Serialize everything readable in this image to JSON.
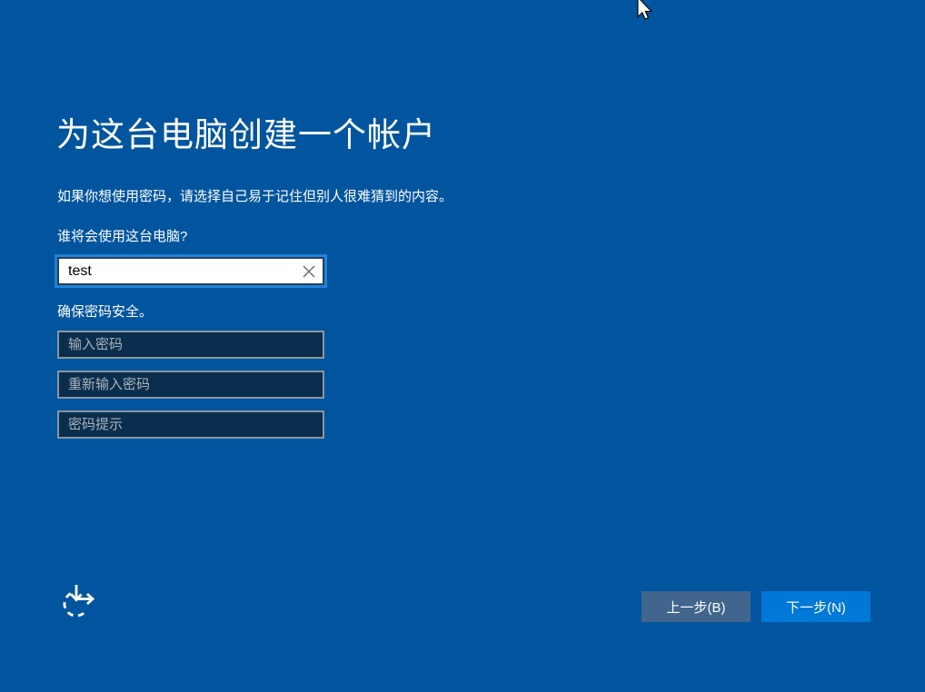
{
  "header": {
    "title": "为这台电脑创建一个帐户",
    "subtitle": "如果你想使用密码，请选择自己易于记住但别人很难猜到的内容。"
  },
  "form": {
    "username_label": "谁将会使用这台电脑?",
    "username_value": "test",
    "password_section_label": "确保密码安全。",
    "password_placeholder": "输入密码",
    "confirm_password_placeholder": "重新输入密码",
    "password_hint_placeholder": "密码提示"
  },
  "footer": {
    "back_label": "上一步(B)",
    "next_label": "下一步(N)"
  },
  "icons": {
    "clear": "clear-x-icon",
    "ease_of_access": "ease-of-access-icon",
    "cursor": "arrow-cursor-icon"
  },
  "colors": {
    "background": "#00559E",
    "accent_next_button": "#0078D7",
    "back_button": "#41658C",
    "field_background": "#0C2E4E",
    "field_border": "#8A96A0",
    "placeholder_text": "#A9B4BC",
    "focus_ring": "#1F82DA",
    "text": "#FFFFFF"
  }
}
